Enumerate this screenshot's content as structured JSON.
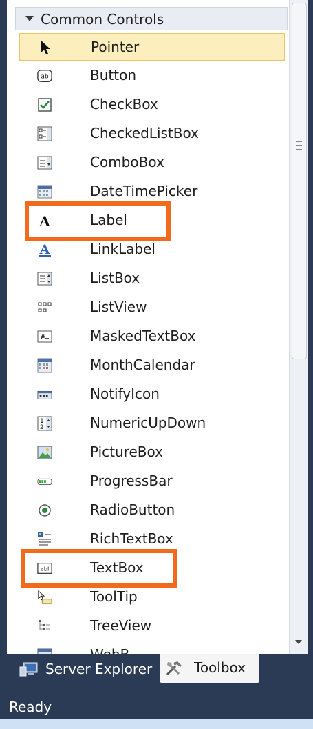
{
  "toolbox": {
    "group_title": "Common Controls",
    "items": [
      {
        "label": "Pointer",
        "icon": "pointer-icon",
        "selected": true
      },
      {
        "label": "Button",
        "icon": "button-icon"
      },
      {
        "label": "CheckBox",
        "icon": "checkbox-icon"
      },
      {
        "label": "CheckedListBox",
        "icon": "checkedlistbox-icon"
      },
      {
        "label": "ComboBox",
        "icon": "combobox-icon"
      },
      {
        "label": "DateTimePicker",
        "icon": "datetimepicker-icon"
      },
      {
        "label": "Label",
        "icon": "label-icon",
        "highlighted": true
      },
      {
        "label": "LinkLabel",
        "icon": "linklabel-icon"
      },
      {
        "label": "ListBox",
        "icon": "listbox-icon"
      },
      {
        "label": "ListView",
        "icon": "listview-icon"
      },
      {
        "label": "MaskedTextBox",
        "icon": "maskedtextbox-icon"
      },
      {
        "label": "MonthCalendar",
        "icon": "monthcalendar-icon"
      },
      {
        "label": "NotifyIcon",
        "icon": "notifyicon-icon"
      },
      {
        "label": "NumericUpDown",
        "icon": "numericupdown-icon"
      },
      {
        "label": "PictureBox",
        "icon": "picturebox-icon"
      },
      {
        "label": "ProgressBar",
        "icon": "progressbar-icon"
      },
      {
        "label": "RadioButton",
        "icon": "radiobutton-icon"
      },
      {
        "label": "RichTextBox",
        "icon": "richtextbox-icon"
      },
      {
        "label": "TextBox",
        "icon": "textbox-icon",
        "highlighted": true
      },
      {
        "label": "ToolTip",
        "icon": "tooltip-icon"
      },
      {
        "label": "TreeView",
        "icon": "treeview-icon"
      },
      {
        "label": "WebB...",
        "icon": "webbrowser-icon"
      }
    ]
  },
  "tabs": [
    {
      "label": "Server Explorer",
      "icon": "server-explorer-icon",
      "active": false
    },
    {
      "label": "Toolbox",
      "icon": "toolbox-icon",
      "active": true
    }
  ],
  "status": {
    "text": "Ready"
  },
  "colors": {
    "highlight": "#f26b1d",
    "selected_bg": "#fcefbd",
    "chrome": "#2b3a55"
  }
}
